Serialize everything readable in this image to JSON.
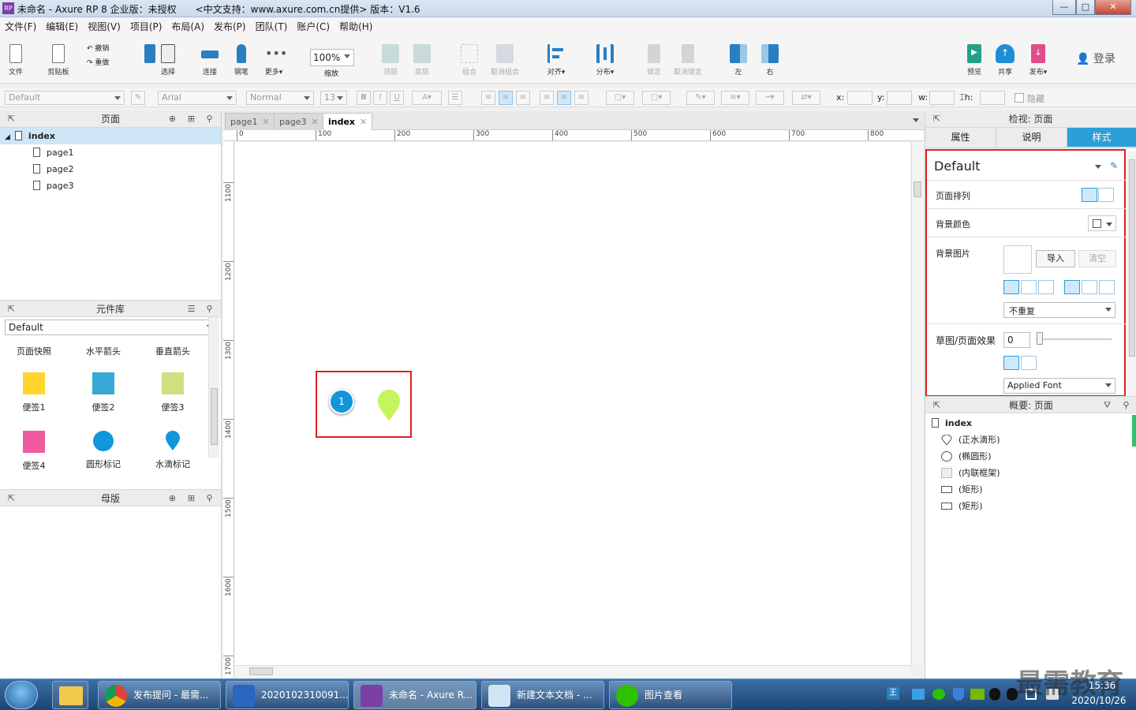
{
  "window": {
    "title": "未命名 - Axure RP 8 企业版：未授权　　<中文支持：www.axure.com.cn提供> 版本：V1.6",
    "app_icon": "RP",
    "minimize": "—",
    "maximize": "□",
    "close": "✕"
  },
  "menu": [
    "文件(F)",
    "编辑(E)",
    "视图(V)",
    "项目(P)",
    "布局(A)",
    "发布(P)",
    "团队(T)",
    "账户(C)",
    "帮助(H)"
  ],
  "toolbar": {
    "file": "文件",
    "clipboard": "剪贴板",
    "undo": "撤销",
    "redo": "重做",
    "select": "选择",
    "connect": "连接",
    "pen": "钢笔",
    "more": "更多▾",
    "zoom_value": "100%",
    "zoom_label": "缩放",
    "top": "顶层",
    "bottom": "底层",
    "group": "组合",
    "ungroup": "取消组合",
    "align": "对齐▾",
    "distribute": "分布▾",
    "lock": "锁定",
    "unlock": "取消锁定",
    "left": "左",
    "right": "右",
    "preview": "预览",
    "share": "共享",
    "publish": "发布▾",
    "login": "登录"
  },
  "format": {
    "style": "Default",
    "font": "Arial",
    "weight": "Normal",
    "size": "13",
    "x_label": "x:",
    "y_label": "y:",
    "w_label": "w:",
    "h_label": "h:",
    "hide_label": "隐藏"
  },
  "pages_panel": {
    "title": "页面",
    "root": "index",
    "children": [
      "page1",
      "page2",
      "page3"
    ]
  },
  "library_panel": {
    "title": "元件库",
    "selected_library": "Default",
    "header_items": [
      "页面快照",
      "水平箭头",
      "垂直箭头"
    ],
    "widgets": [
      {
        "label": "便签1",
        "color": "#ffd52e"
      },
      {
        "label": "便签2",
        "color": "#37a9d4"
      },
      {
        "label": "便签3",
        "color": "#cfe07f"
      },
      {
        "label": "便签4",
        "color": "#f25aa0"
      },
      {
        "label": "圆形标记",
        "color": "#1296db"
      },
      {
        "label": "水滴标记",
        "color": "#1296db"
      }
    ]
  },
  "masters_panel": {
    "title": "母版"
  },
  "tabs": [
    {
      "label": "page1",
      "active": false
    },
    {
      "label": "page3",
      "active": false
    },
    {
      "label": "index",
      "active": true
    }
  ],
  "ruler": {
    "horizontal": [
      "0",
      "100",
      "200",
      "300",
      "400",
      "500",
      "600",
      "700",
      "800"
    ],
    "vertical": [
      "1100",
      "1200",
      "1300",
      "1400",
      "1500",
      "1600",
      "1700"
    ]
  },
  "canvas": {
    "circle_marker_text": "1",
    "circle_color": "#1296db",
    "drop_color": "#c4f55a",
    "highlight_color": "#e02020"
  },
  "inspector": {
    "title": "检视: 页面",
    "tabs": [
      "属性",
      "说明",
      "样式"
    ],
    "active_tab": "样式",
    "style_name": "Default",
    "page_align_label": "页面排列",
    "bg_color_label": "背景颜色",
    "bg_image_label": "背景图片",
    "import_button": "导入",
    "clear_button": "清空",
    "repeat_option": "不重复",
    "sketch_label": "草图/页面效果",
    "sketch_value": "0",
    "font_option": "Applied Font"
  },
  "outline_panel": {
    "title": "概要: 页面",
    "root": "index",
    "items": [
      {
        "label": "(正水滴形)",
        "icon": "drop-icon"
      },
      {
        "label": "(椭圆形)",
        "icon": "ellipse-icon"
      },
      {
        "label": "(内联框架)",
        "icon": "inline-frame-icon"
      },
      {
        "label": "(矩形)",
        "icon": "rectangle-icon"
      },
      {
        "label": "(矩形)",
        "icon": "rectangle-icon"
      }
    ]
  },
  "taskbar": {
    "items": [
      "发布提问 - 最需...",
      "2020102310091...",
      "未命名 - Axure R...",
      "新建文本文档 - ...",
      "图片查看"
    ],
    "time": "15:36",
    "date": "2020/10/26",
    "watermark": "最需教育"
  }
}
